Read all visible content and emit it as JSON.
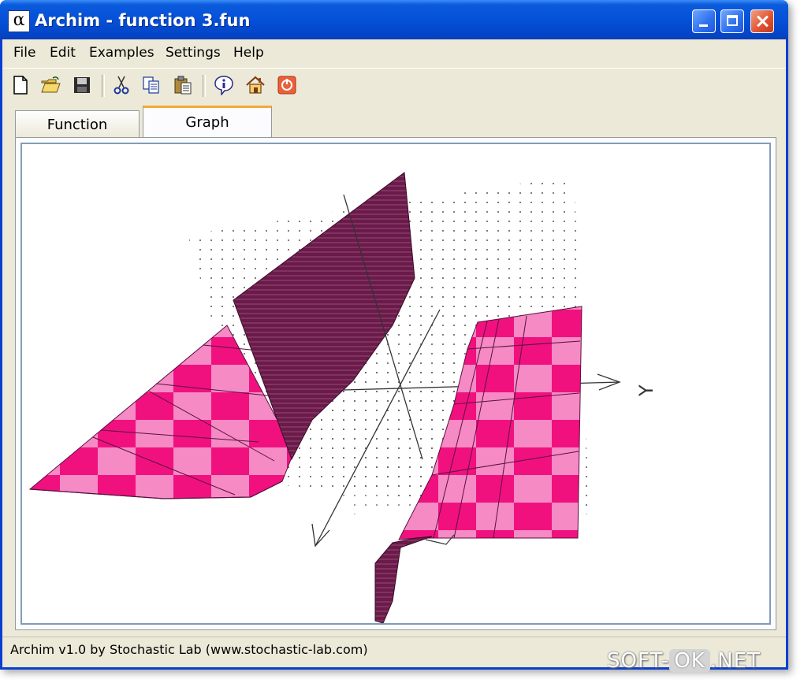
{
  "window": {
    "title": "Archim - function 3.fun",
    "app_icon_glyph": "α"
  },
  "menu": {
    "items": [
      "File",
      "Edit",
      "Examples",
      "Settings",
      "Help"
    ]
  },
  "toolbar": {
    "icons": [
      "new-file-icon",
      "open-folder-icon",
      "save-disk-icon",
      "cut-icon",
      "copy-icon",
      "paste-icon",
      "info-icon",
      "home-icon",
      "stop-icon"
    ]
  },
  "tabs": {
    "function_label": "Function",
    "graph_label": "Graph",
    "active": "Graph"
  },
  "graph": {
    "axis_label": "Y",
    "colors": {
      "dark_surface": "#6b1a4a",
      "hot_pink": "#f0117f",
      "light_pink": "#f58ac4",
      "grid_dots": "#555555",
      "axis": "#333333"
    }
  },
  "status": {
    "text": "Archim v1.0 by Stochastic Lab (www.stochastic-lab.com)"
  },
  "watermark": {
    "left": "SOFT-",
    "box": "OK",
    "right": ".NET"
  }
}
